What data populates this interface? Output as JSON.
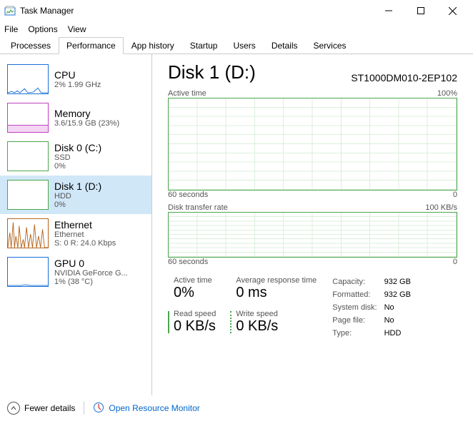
{
  "window": {
    "title": "Task Manager"
  },
  "menu": {
    "file": "File",
    "options": "Options",
    "view": "View"
  },
  "tabs": {
    "processes": "Processes",
    "performance": "Performance",
    "app_history": "App history",
    "startup": "Startup",
    "users": "Users",
    "details": "Details",
    "services": "Services"
  },
  "sidebar": [
    {
      "title": "CPU",
      "sub": "2%  1.99 GHz",
      "color": "#1a6fd6"
    },
    {
      "title": "Memory",
      "sub": "3.6/15.9 GB (23%)",
      "color": "#c040c0"
    },
    {
      "title": "Disk 0 (C:)",
      "sub1": "SSD",
      "sub2": "0%",
      "color": "#4ca64c"
    },
    {
      "title": "Disk 1 (D:)",
      "sub1": "HDD",
      "sub2": "0%",
      "color": "#4ca64c",
      "selected": true
    },
    {
      "title": "Ethernet",
      "sub1": "Ethernet",
      "sub2": "S: 0  R: 24.0 Kbps",
      "color": "#b5651d"
    },
    {
      "title": "GPU 0",
      "sub1": "NVIDIA GeForce G...",
      "sub2": "1%  (38 °C)",
      "color": "#1a6fd6"
    }
  ],
  "main": {
    "title": "Disk 1 (D:)",
    "model": "ST1000DM010-2EP102",
    "chart1": {
      "label": "Active time",
      "right": "100%",
      "axis_l": "60 seconds",
      "axis_r": "0"
    },
    "chart2": {
      "label": "Disk transfer rate",
      "right": "100 KB/s",
      "axis_l": "60 seconds",
      "axis_r": "0"
    },
    "stats": {
      "active_time_l": "Active time",
      "active_time_v": "0%",
      "avg_resp_l": "Average response time",
      "avg_resp_v": "0 ms",
      "read_l": "Read speed",
      "read_v": "0 KB/s",
      "write_l": "Write speed",
      "write_v": "0 KB/s"
    },
    "kv": {
      "capacity_l": "Capacity:",
      "capacity_v": "932 GB",
      "formatted_l": "Formatted:",
      "formatted_v": "932 GB",
      "sys_l": "System disk:",
      "sys_v": "No",
      "page_l": "Page file:",
      "page_v": "No",
      "type_l": "Type:",
      "type_v": "HDD"
    }
  },
  "footer": {
    "fewer": "Fewer details",
    "resmon": "Open Resource Monitor"
  },
  "chart_data": [
    {
      "type": "line",
      "title": "Active time",
      "xlabel": "60 seconds",
      "ylabel": "",
      "ylim": [
        0,
        100
      ],
      "xlim": [
        60,
        0
      ],
      "series": [
        {
          "name": "Active time %",
          "values": [
            0,
            0,
            0,
            0,
            0,
            0,
            0,
            0,
            0,
            0,
            0
          ]
        }
      ]
    },
    {
      "type": "line",
      "title": "Disk transfer rate",
      "xlabel": "60 seconds",
      "ylabel": "",
      "ylim": [
        0,
        100
      ],
      "xlim": [
        60,
        0
      ],
      "series": [
        {
          "name": "Read speed KB/s",
          "values": [
            0,
            0,
            0,
            0,
            0,
            0,
            0,
            0,
            0,
            0,
            0
          ]
        },
        {
          "name": "Write speed KB/s",
          "values": [
            0,
            0,
            0,
            0,
            0,
            0,
            0,
            0,
            0,
            0,
            0
          ]
        }
      ]
    }
  ]
}
